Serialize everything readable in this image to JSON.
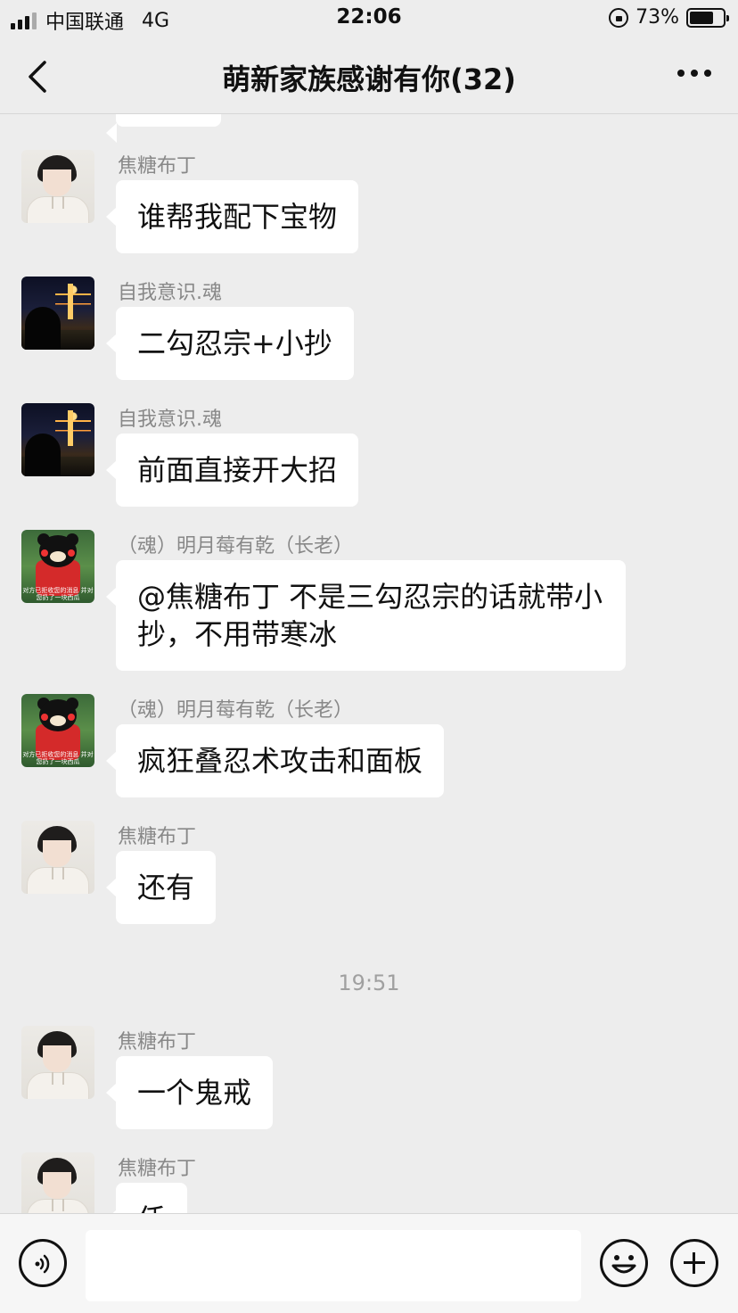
{
  "status_bar": {
    "carrier": "中国联通",
    "network": "4G",
    "time": "22:06",
    "battery_percent": "73%",
    "battery_level": 0.73
  },
  "nav": {
    "title": "萌新家族感谢有你(32)"
  },
  "messages": [
    {
      "sender": "焦糖布丁",
      "avatar": "boy-avatar",
      "text": "谁帮我配下宝物"
    },
    {
      "sender": "自我意识.魂",
      "avatar": "night-city-avatar",
      "text": "二勾忍宗+小抄"
    },
    {
      "sender": "自我意识.魂",
      "avatar": "night-city-avatar",
      "text": "前面直接开大招"
    },
    {
      "sender": "（魂）明月莓有乾（长老）",
      "avatar": "bear-avatar",
      "text": "@焦糖布丁 不是三勾忍宗的话就带小抄，不用带寒冰"
    },
    {
      "sender": "（魂）明月莓有乾（长老）",
      "avatar": "bear-avatar",
      "text": "疯狂叠忍术攻击和面板"
    },
    {
      "sender": "焦糖布丁",
      "avatar": "boy-avatar",
      "text": "还有"
    },
    {
      "sender": "焦糖布丁",
      "avatar": "boy-avatar",
      "text": "一个鬼戒"
    },
    {
      "sender": "焦糖布丁",
      "avatar": "boy-avatar",
      "text": "仸"
    }
  ],
  "timestamp": "19:51",
  "bear_avatar_caption": "对方已拒收您的消息 并对您扔了一块西瓜",
  "input": {
    "placeholder": ""
  },
  "icons": {
    "back": "chevron-left-icon",
    "more": "more-dots-icon",
    "voice": "voice-icon",
    "emoji": "emoji-icon",
    "plus": "plus-icon"
  }
}
